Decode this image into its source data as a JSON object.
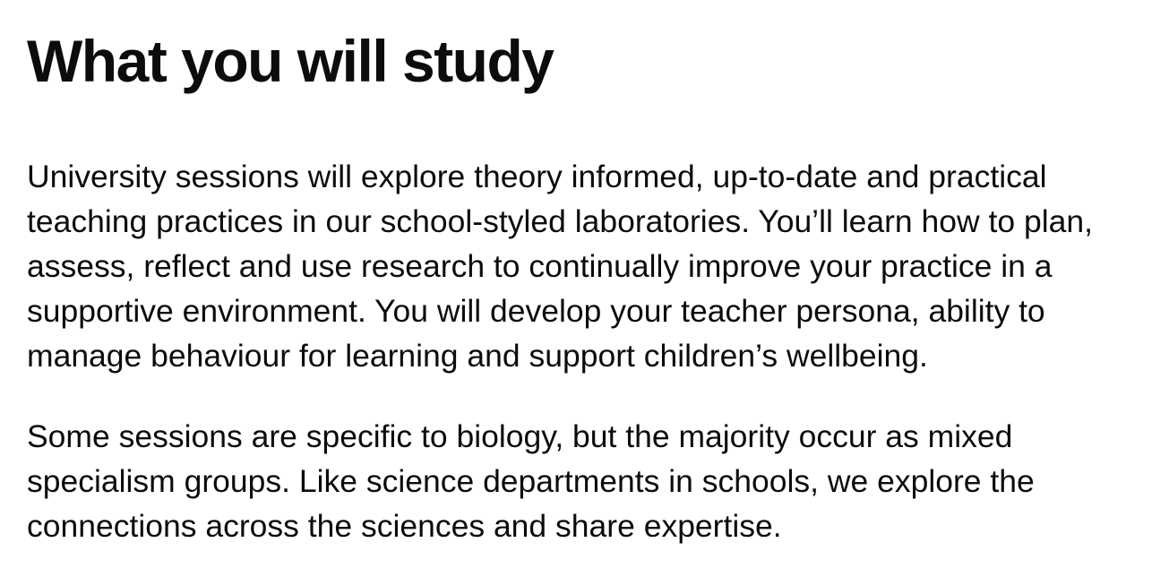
{
  "section": {
    "heading": "What you will study",
    "paragraphs": [
      "University sessions will explore theory informed, up-to-date and practical teaching practices in our school-styled laboratories. You’ll learn how to plan, assess, reflect and use research to continually improve your practice in a supportive environment. You will develop your teacher persona, ability to manage behaviour for learning and support children’s wellbeing.",
      "Some sessions are specific to biology, but the majority occur as mixed specialism groups. Like science departments in schools, we explore the connections across the sciences and share expertise."
    ]
  }
}
